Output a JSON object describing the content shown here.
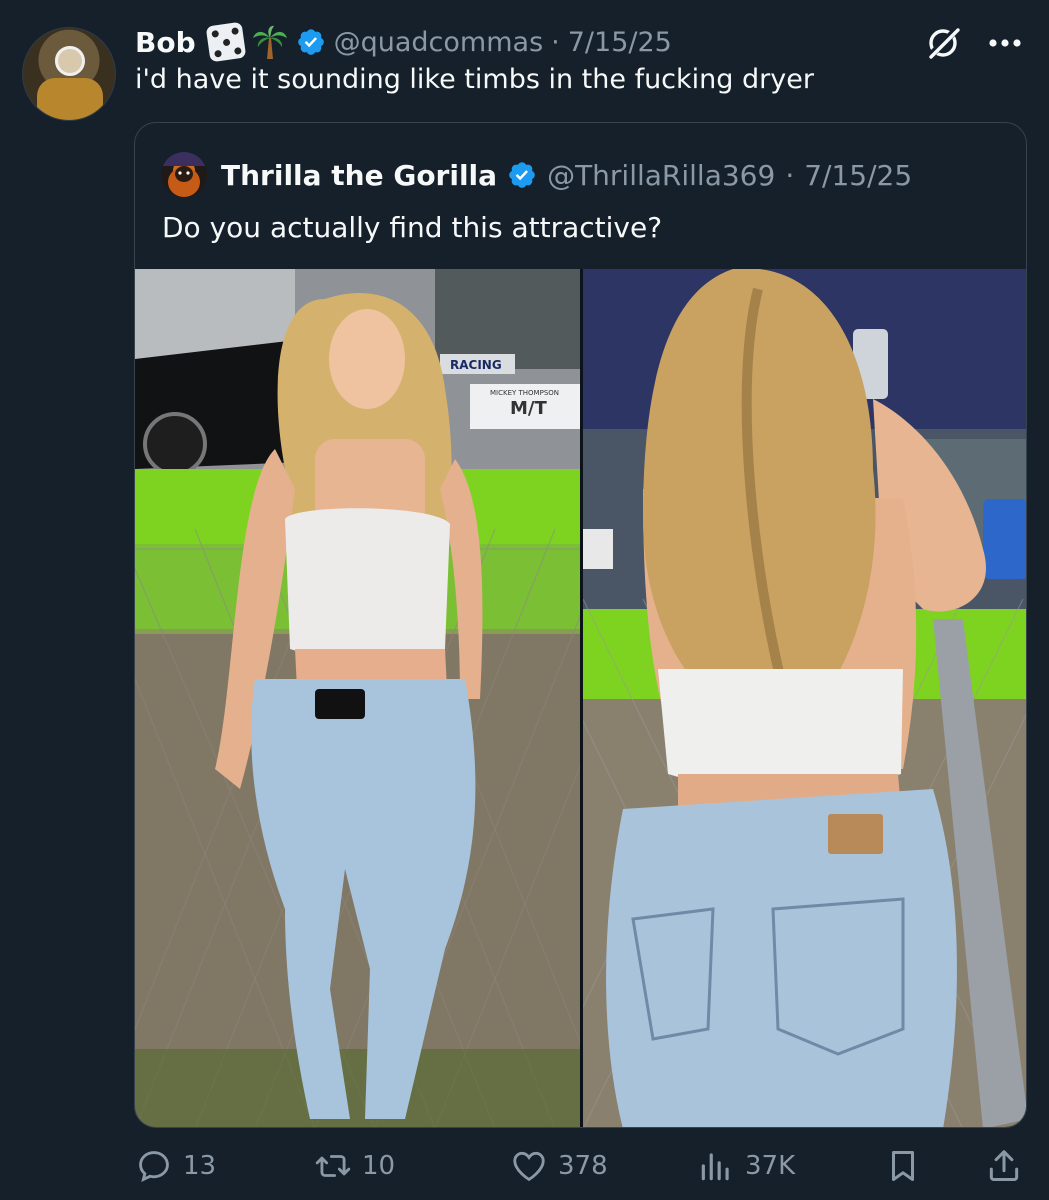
{
  "tweet": {
    "author_name": "Bob",
    "handle": "@quadcommas",
    "date": "7/15/25",
    "text": "i'd have it sounding like timbs in the fucking dryer",
    "separator": "·"
  },
  "quoted_tweet": {
    "author_name": "Thrilla the Gorilla",
    "handle": "@ThrillaRilla369",
    "date": "7/15/25",
    "text": "Do you actually find this attractive?",
    "separator": "·",
    "media_signs": {
      "racing": "RACING",
      "mickey": "MICKEY THOMPSON",
      "mt": "M/T"
    }
  },
  "actions": {
    "replies": "13",
    "reposts": "10",
    "likes": "378",
    "views": "37K"
  },
  "icons": {
    "emoji_1": "game-die",
    "emoji_2": "palm-tree",
    "verified": "verified-badge-icon",
    "grok": "grok-icon",
    "more": "more-icon"
  },
  "colors": {
    "background": "#15202b",
    "text": "#f7f9f9",
    "secondary": "#8b98a5",
    "verified": "#1d9bf0",
    "border": "#38444d"
  }
}
